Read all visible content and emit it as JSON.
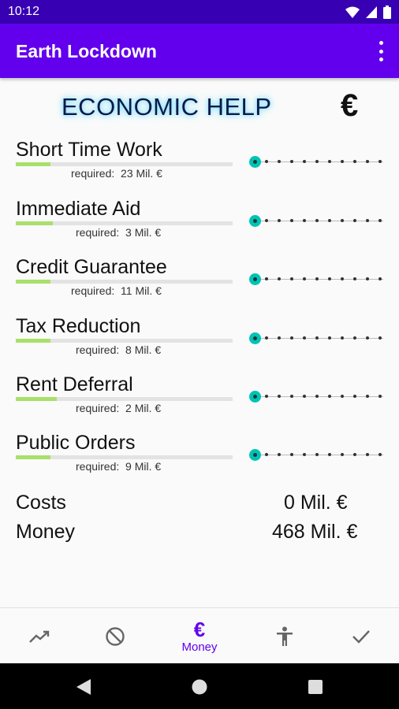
{
  "status": {
    "time": "10:12"
  },
  "app": {
    "title": "Earth Lockdown"
  },
  "heading": {
    "title": "ECONOMIC HELP",
    "symbol": "€"
  },
  "measures": [
    {
      "label": "Short Time Work",
      "required_label": "required:",
      "required_value": "23 Mil. €",
      "progress": 0.16
    },
    {
      "label": "Immediate Aid",
      "required_label": "required:",
      "required_value": "3 Mil. €",
      "progress": 0.17
    },
    {
      "label": "Credit Guarantee",
      "required_label": "required:",
      "required_value": "11 Mil. €",
      "progress": 0.16
    },
    {
      "label": "Tax Reduction",
      "required_label": "required:",
      "required_value": "8 Mil. €",
      "progress": 0.16
    },
    {
      "label": "Rent Deferral",
      "required_label": "required:",
      "required_value": "2 Mil. €",
      "progress": 0.19
    },
    {
      "label": "Public Orders",
      "required_label": "required:",
      "required_value": "9 Mil. €",
      "progress": 0.16
    }
  ],
  "summary": {
    "costs_label": "Costs",
    "costs_value": "0 Mil. €",
    "money_label": "Money",
    "money_value": "468 Mil. €"
  },
  "bottom_nav": {
    "items": [
      {
        "icon": "trending-up-icon",
        "label": ""
      },
      {
        "icon": "block-icon",
        "label": ""
      },
      {
        "icon": "euro-icon",
        "label": "Money"
      },
      {
        "icon": "accessibility-icon",
        "label": ""
      },
      {
        "icon": "check-icon",
        "label": ""
      }
    ]
  },
  "colors": {
    "status_bar": "#3700b3",
    "app_bar": "#6200ee",
    "accent": "#00c3b5",
    "progress_fill": "#a8e06a",
    "active_nav": "#6200ee"
  }
}
